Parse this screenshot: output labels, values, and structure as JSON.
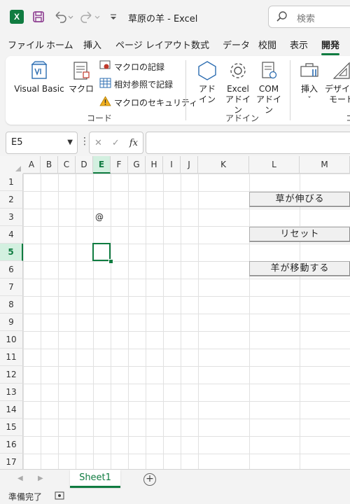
{
  "titlebar": {
    "title": "草原の羊  -  Excel",
    "app_icon_letter": "X",
    "search_placeholder": "検索"
  },
  "ribbon_tabs": [
    {
      "label": "ファイル"
    },
    {
      "label": "ホーム"
    },
    {
      "label": "挿入"
    },
    {
      "label": "ページ レイアウト"
    },
    {
      "label": "数式"
    },
    {
      "label": "データ"
    },
    {
      "label": "校閲"
    },
    {
      "label": "表示"
    },
    {
      "label": "開発",
      "active": true
    }
  ],
  "ribbon": {
    "code_group": {
      "label": "コード",
      "visual_basic": "Visual Basic",
      "macro": "マクロ",
      "record_macro": "マクロの記録",
      "relative_ref": "相対参照で記録",
      "macro_security": "マクロのセキュリティ"
    },
    "addin_group": {
      "label": "アドイン",
      "addin_line1": "アド",
      "addin_line2": "イン",
      "excel_addin_line1": "Excel",
      "excel_addin_line2": "アドイン",
      "com_addin_line1": "COM",
      "com_addin_line2": "アドイン"
    },
    "controls_group": {
      "insert": "挿入",
      "insert_caret": "ˇ",
      "design_line1": "デザイン",
      "design_line2": "モード",
      "group_label_partial": "コ"
    }
  },
  "formula_bar": {
    "name_box": "E5",
    "formula": ""
  },
  "grid": {
    "columns": [
      "A",
      "B",
      "C",
      "D",
      "E",
      "F",
      "G",
      "H",
      "I",
      "J",
      "K",
      "L",
      "M"
    ],
    "rows": [
      "1",
      "2",
      "3",
      "4",
      "5",
      "6",
      "7",
      "8",
      "9",
      "10",
      "11",
      "12",
      "13",
      "14",
      "15",
      "16",
      "17"
    ],
    "selected_column": "E",
    "selected_row": "5",
    "cells": [
      {
        "ref": "E3",
        "value": "@"
      }
    ]
  },
  "buttons": {
    "grow_grass": "草が伸びる",
    "reset": "リセット",
    "move_sheep": "羊が移動する"
  },
  "sheets": {
    "tabs": [
      "Sheet1"
    ],
    "add_label": "+"
  },
  "status": {
    "ready": "準備完了"
  }
}
